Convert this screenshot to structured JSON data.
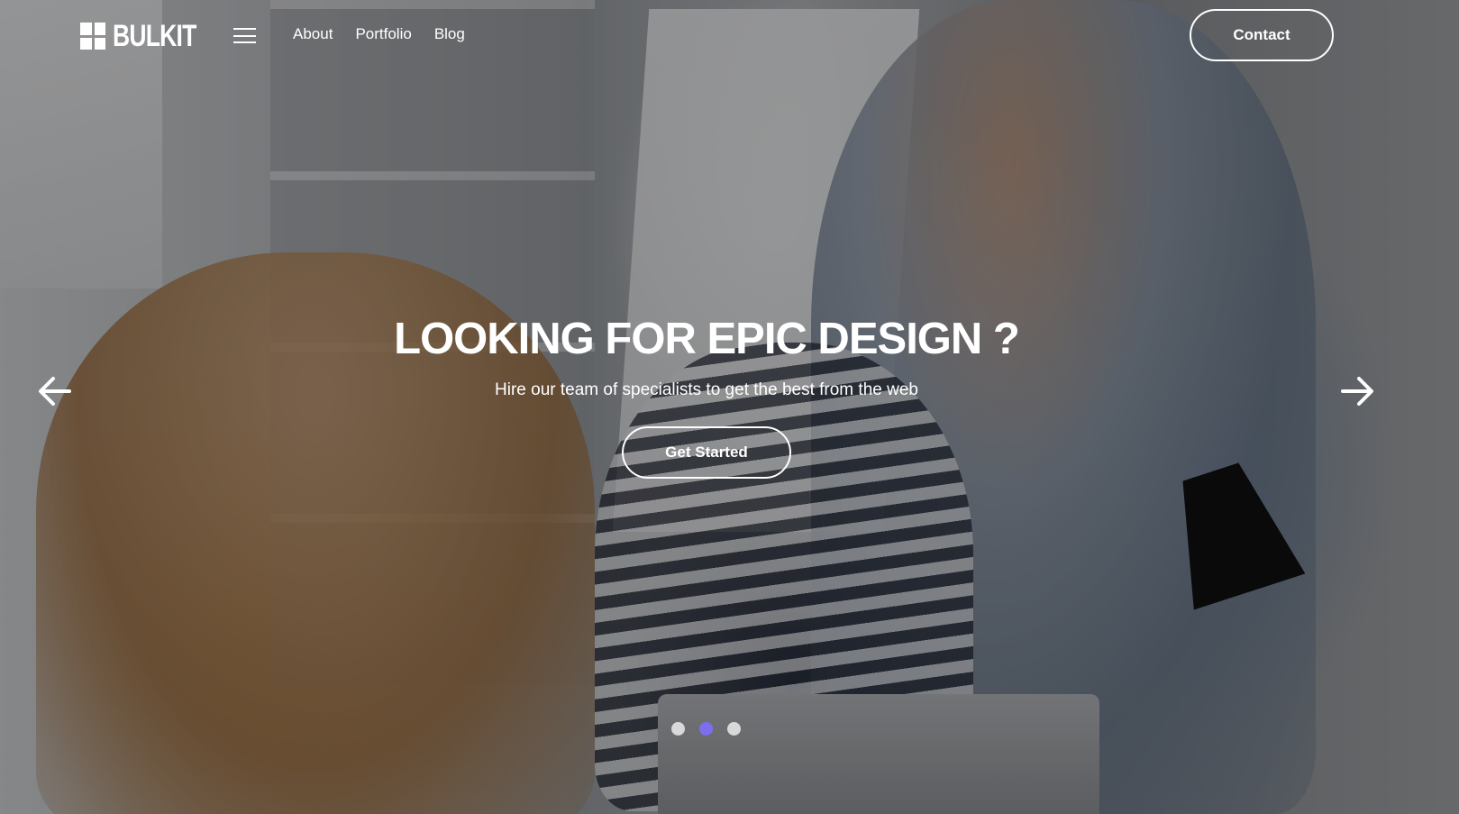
{
  "brand": {
    "name": "BULKIT",
    "logo_icon": "grid-logo-icon"
  },
  "nav": {
    "menu_icon": "hamburger-menu-icon",
    "links": [
      "About",
      "Portfolio",
      "Blog"
    ],
    "contact_label": "Contact"
  },
  "hero": {
    "headline": "LOOKING FOR EPIC DESIGN ?",
    "subheadline": "Hire our team of specialists to get the best from the web",
    "cta_label": "Get Started",
    "background": "office-team-photo"
  },
  "carousel": {
    "prev_icon": "arrow-left-icon",
    "next_icon": "arrow-right-icon",
    "slide_count": 3,
    "active_slide": 2,
    "colors": {
      "dot": "#d9d9d9",
      "dot_active": "#7b6ff0"
    }
  }
}
